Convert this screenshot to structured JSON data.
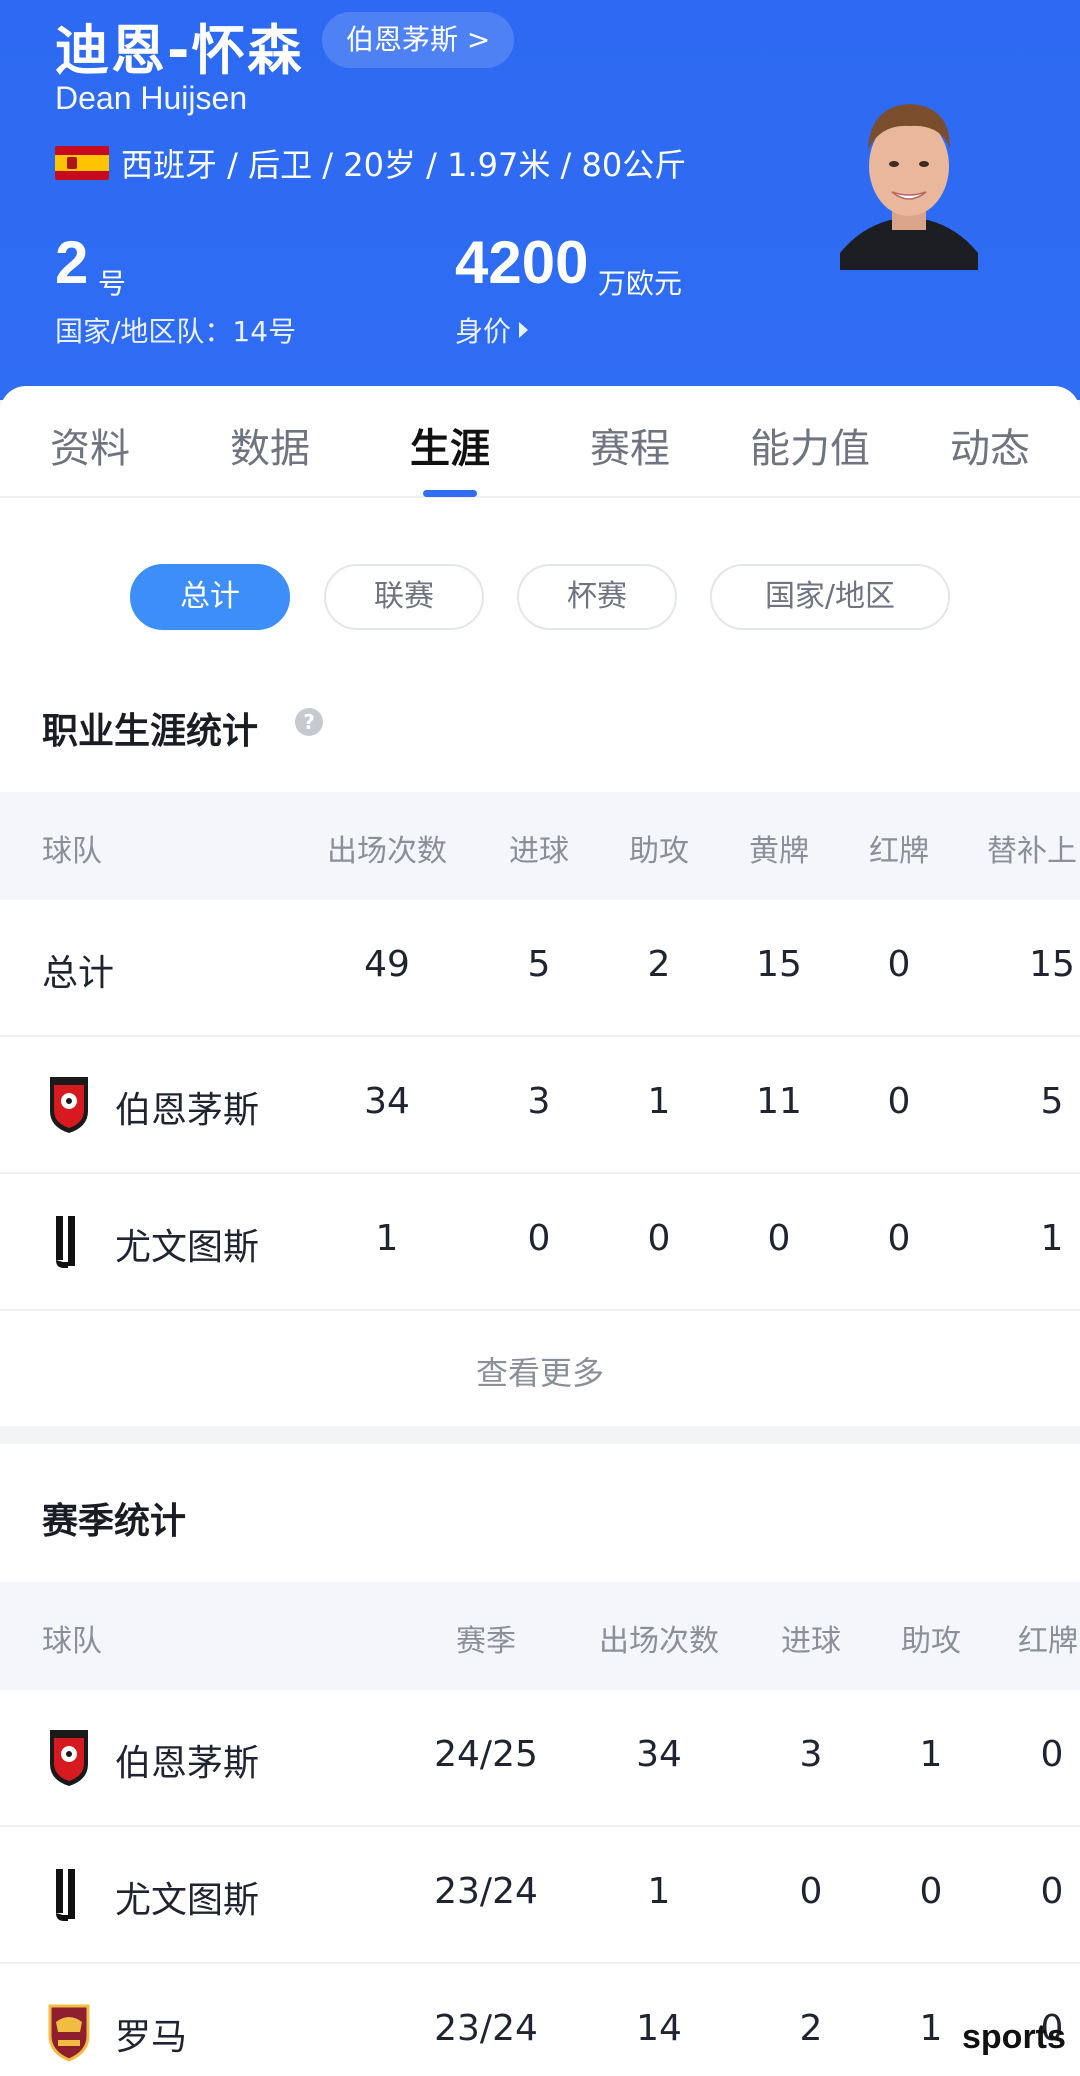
{
  "header": {
    "name_cn": "迪恩-怀森",
    "club_pill": "伯恩茅斯 >",
    "name_en": "Dean Huijsen",
    "info": "西班牙 / 后卫 / 20岁 / 1.97米 / 80公斤",
    "shirt_number": "2",
    "shirt_unit": "号",
    "national_number": "国家/地区队：14号",
    "market_value": "4200",
    "market_value_unit": "万欧元",
    "market_value_label": "身价"
  },
  "tabs": [
    "资料",
    "数据",
    "生涯",
    "赛程",
    "能力值",
    "动态"
  ],
  "filters": [
    "总计",
    "联赛",
    "杯赛",
    "国家/地区"
  ],
  "career": {
    "title": "职业生涯统计",
    "help_icon": "question-icon",
    "columns": [
      "球队",
      "出场次数",
      "进球",
      "助攻",
      "黄牌",
      "红牌",
      "替补上"
    ],
    "rows": [
      {
        "team": "总计",
        "apps": "49",
        "goals": "5",
        "assists": "2",
        "yellow": "15",
        "red": "0",
        "sub": "15"
      },
      {
        "team": "伯恩茅斯",
        "apps": "34",
        "goals": "3",
        "assists": "1",
        "yellow": "11",
        "red": "0",
        "sub": "5"
      },
      {
        "team": "尤文图斯",
        "apps": "1",
        "goals": "0",
        "assists": "0",
        "yellow": "0",
        "red": "0",
        "sub": "1"
      }
    ],
    "more": "查看更多"
  },
  "season": {
    "title": "赛季统计",
    "columns": [
      "球队",
      "赛季",
      "出场次数",
      "进球",
      "助攻",
      "红牌"
    ],
    "rows": [
      {
        "team": "伯恩茅斯",
        "season": "24/25",
        "apps": "34",
        "goals": "3",
        "assists": "1",
        "red": "0"
      },
      {
        "team": "尤文图斯",
        "season": "23/24",
        "apps": "1",
        "goals": "0",
        "assists": "0",
        "red": "0"
      },
      {
        "team": "罗马",
        "season": "23/24",
        "apps": "14",
        "goals": "2",
        "assists": "1",
        "red": "0"
      }
    ]
  },
  "watermark": "sports",
  "colors": {
    "primary": "#2f6df3",
    "filter_active": "#3d8ef8"
  }
}
